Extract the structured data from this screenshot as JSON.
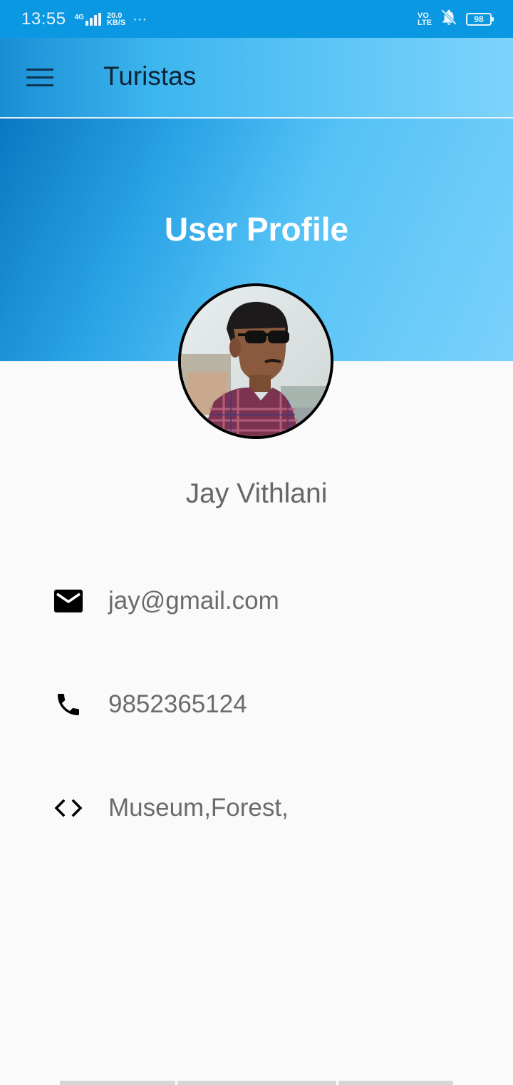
{
  "status_bar": {
    "time": "13:55",
    "network_type": "4G",
    "speed_value": "20.0",
    "speed_unit": "KB/S",
    "more": "···",
    "volte_top": "VO",
    "volte_bottom": "LTE",
    "battery": "98"
  },
  "app_bar": {
    "title": "Turistas",
    "menu_icon": "hamburger-menu-icon"
  },
  "profile": {
    "heading": "User Profile",
    "name": "Jay Vithlani",
    "email": "jay@gmail.com",
    "phone": "9852365124",
    "interests": "Museum,Forest,"
  },
  "icons": {
    "email": "mail-icon",
    "phone": "phone-icon",
    "interests": "code-icon"
  },
  "colors": {
    "status_bar": "#0b98e2",
    "gradient_start": "#0a77c2",
    "gradient_end": "#7bd1fb",
    "text_gray": "#6b6b6b",
    "background": "#fafafa"
  }
}
